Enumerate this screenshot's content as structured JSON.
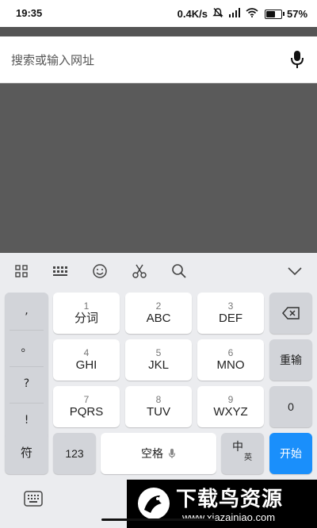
{
  "status_bar": {
    "time": "19:35",
    "net_speed": "0.4K/s",
    "battery": "57",
    "battery_unit": "%"
  },
  "search": {
    "placeholder": "搜索或输入网址"
  },
  "keyboard": {
    "toolbar": [
      "grid-icon",
      "keyboard-icon",
      "smile-icon",
      "scissors-icon",
      "search-icon",
      "chevron-down-icon"
    ],
    "punctuation": [
      ",",
      "。",
      "?",
      "!"
    ],
    "keys": {
      "k1": {
        "num": "1",
        "letters": "分词"
      },
      "k2": {
        "num": "2",
        "letters": "ABC"
      },
      "k3": {
        "num": "3",
        "letters": "DEF"
      },
      "k4": {
        "num": "4",
        "letters": "GHI"
      },
      "k5": {
        "num": "5",
        "letters": "JKL"
      },
      "k6": {
        "num": "6",
        "letters": "MNO"
      },
      "k7": {
        "num": "7",
        "letters": "PQRS"
      },
      "k8": {
        "num": "8",
        "letters": "TUV"
      },
      "k9": {
        "num": "9",
        "letters": "WXYZ"
      }
    },
    "reenter": "重输",
    "zero": "0",
    "symbols": "符",
    "numeric": "123",
    "space": "空格",
    "lang_main": "中",
    "lang_sub": "英",
    "go": "开始"
  },
  "watermark": {
    "title": "下载鸟资源",
    "url": "www.xiazainiao.com"
  },
  "colors": {
    "accent": "#1a8ffb",
    "keyboard_bg": "#ebecef",
    "page_bg": "#5a5a5a"
  }
}
